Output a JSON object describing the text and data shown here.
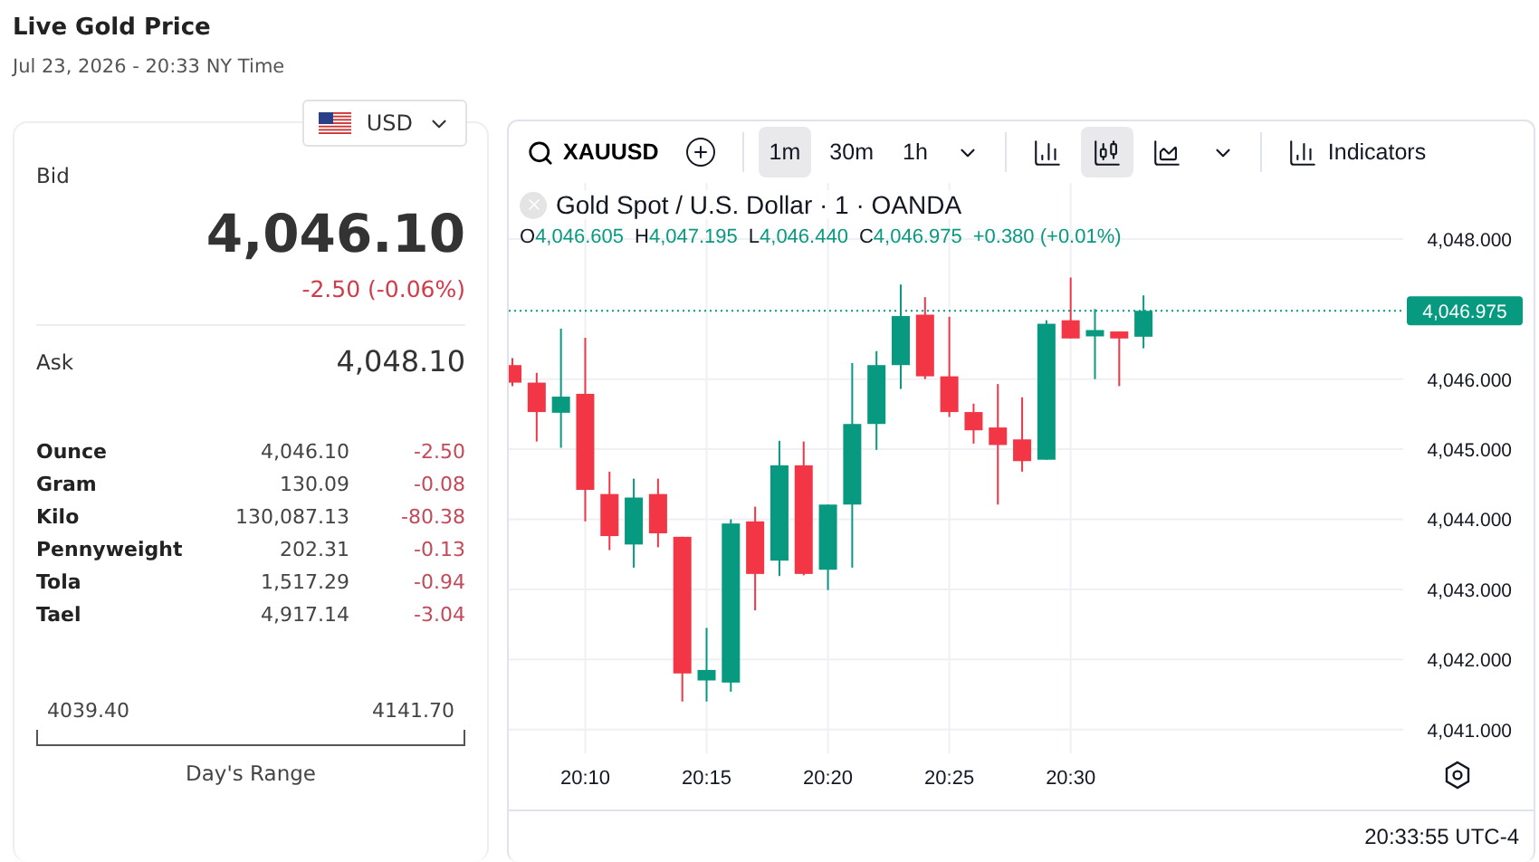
{
  "header": {
    "title": "Live Gold Price",
    "timestamp": "Jul 23, 2026 - 20:33 NY Time"
  },
  "currency": {
    "value": "USD"
  },
  "quote": {
    "bid_label": "Bid",
    "bid": "4,046.10",
    "change": "-2.50 (-0.06%)",
    "ask_label": "Ask",
    "ask": "4,048.10"
  },
  "units": [
    {
      "name": "Ounce",
      "price": "4,046.10",
      "change": "-2.50"
    },
    {
      "name": "Gram",
      "price": "130.09",
      "change": "-0.08"
    },
    {
      "name": "Kilo",
      "price": "130,087.13",
      "change": "-80.38"
    },
    {
      "name": "Pennyweight",
      "price": "202.31",
      "change": "-0.13"
    },
    {
      "name": "Tola",
      "price": "1,517.29",
      "change": "-0.94"
    },
    {
      "name": "Tael",
      "price": "4,917.14",
      "change": "-3.04"
    }
  ],
  "days_range": {
    "low": "4039.40",
    "high": "4141.70",
    "label": "Day's Range"
  },
  "toolbar": {
    "symbol": "XAUUSD",
    "intervals": [
      {
        "label": "1m",
        "selected": true
      },
      {
        "label": "30m",
        "selected": false
      },
      {
        "label": "1h",
        "selected": false
      }
    ],
    "chart_types": [
      {
        "kind": "bars",
        "selected": false
      },
      {
        "kind": "candles",
        "selected": true
      },
      {
        "kind": "area",
        "selected": false
      }
    ],
    "indicators": "Indicators"
  },
  "legend": {
    "title": "Gold Spot / U.S. Dollar · 1 · OANDA",
    "ohlc": [
      {
        "label": "O",
        "value": "4,046.605"
      },
      {
        "label": "H",
        "value": "4,047.195"
      },
      {
        "label": "L",
        "value": "4,046.440"
      },
      {
        "label": "C",
        "value": "4,046.975"
      }
    ],
    "change": "+0.380 (+0.01%)"
  },
  "chart": {
    "price_ticks": [
      "4,048.000",
      "4,046.000",
      "4,045.000",
      "4,044.000",
      "4,043.000",
      "4,042.000",
      "4,041.000"
    ],
    "time_ticks": [
      "20:10",
      "20:15",
      "20:20",
      "20:25",
      "20:30"
    ],
    "last_price": "4,046.975",
    "clock": "20:33:55 UTC-4"
  }
}
